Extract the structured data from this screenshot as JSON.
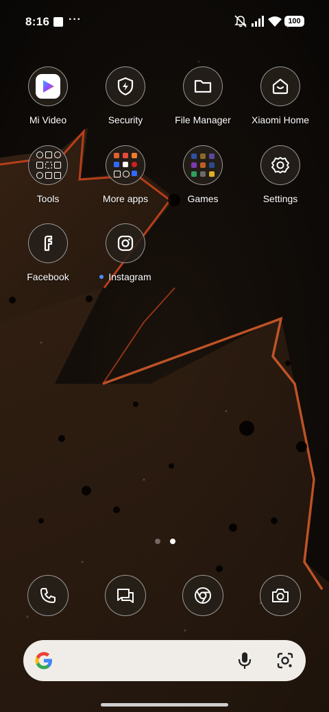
{
  "status_bar": {
    "time": "8:16",
    "more": "···",
    "battery": "100",
    "icons": [
      "image-notification-icon",
      "silent-bell-icon",
      "signal-icon",
      "wifi-icon",
      "battery-icon"
    ]
  },
  "apps": [
    {
      "label": "Mi Video",
      "icon": "play-icon"
    },
    {
      "label": "Security",
      "icon": "shield-bolt-icon"
    },
    {
      "label": "File Manager",
      "icon": "folder-icon"
    },
    {
      "label": "Xiaomi Home",
      "icon": "home-icon"
    },
    {
      "label": "Tools",
      "icon": "folder-icon"
    },
    {
      "label": "More apps",
      "icon": "folder-icon"
    },
    {
      "label": "Games",
      "icon": "folder-icon"
    },
    {
      "label": "Settings",
      "icon": "gear-icon"
    },
    {
      "label": "Facebook",
      "icon": "facebook-icon"
    },
    {
      "label": "Instagram",
      "icon": "instagram-icon",
      "new": true
    }
  ],
  "page_indicator": {
    "pages": 2,
    "current": 2
  },
  "dock": [
    "phone-icon",
    "messages-icon",
    "chrome-icon",
    "camera-icon"
  ],
  "search_bar": {
    "placeholder": "",
    "icons": [
      "google-logo-icon",
      "microphone-icon",
      "lens-icon"
    ]
  },
  "colors": {
    "accent_glow": "#c8431c",
    "folder_blue": "#2f6bff",
    "notification_dot": "#4a8cff"
  }
}
